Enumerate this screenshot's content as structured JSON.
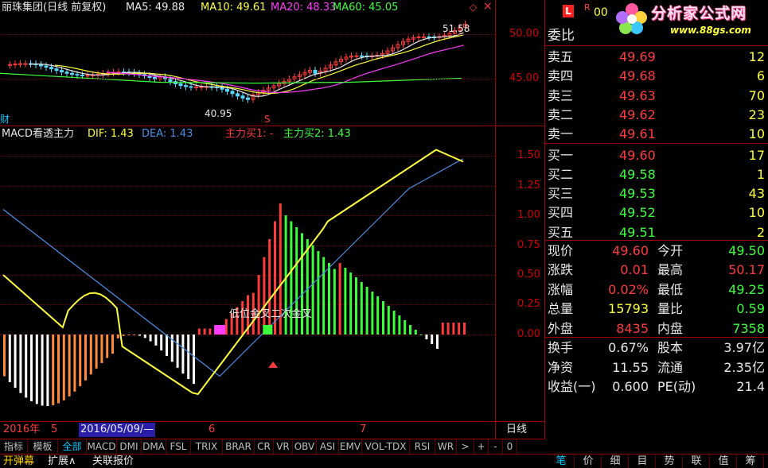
{
  "upper": {
    "stock_title": "丽珠集团(日线 前复权)",
    "ma5_label": "MA5: 49.88",
    "ma10_label": "MA10: 49.61",
    "ma20_label": "MA20: 48.33",
    "ma60_label": "MA60: 45.05",
    "high_marker": "51.58",
    "low_marker": "40.95",
    "side_glyph": "财",
    "buy_glyph": "S",
    "y_ticks": [
      "50.00",
      "45.00"
    ]
  },
  "lower": {
    "indicator_title": "MACD看透主力",
    "dif_label": "DIF: 1.43",
    "dea_label": "DEA: 1.43",
    "buy1_label": "主力买1: -",
    "buy2_label": "主力买2: 1.43",
    "annotation1": "低位金叉",
    "annotation2": "二次金叉",
    "y_ticks": [
      "1.50",
      "1.25",
      "1.00",
      "0.75",
      "0.50",
      "0.25",
      "0.00"
    ]
  },
  "timeline": {
    "year_label": "2016年",
    "m5": "5",
    "date_box": "2016/05/09/—",
    "m6": "6",
    "m7": "7",
    "period": "日线"
  },
  "tabs": [
    "指标",
    "模板",
    "全部",
    "MACD",
    "DMI",
    "DMA",
    "FSL",
    "TRIX",
    "BRAR",
    "CR",
    "VR",
    "OBV",
    "ASI",
    "EMV",
    "VOL-TDX",
    "RSI",
    "WR",
    ">",
    "+",
    "-",
    "0"
  ],
  "bottom_tabs": [
    "开弹幕",
    "扩展∧",
    "关联报价"
  ],
  "right_tabs": [
    "笔",
    "价",
    "细",
    "目",
    "势",
    "联",
    "值",
    "筹"
  ],
  "quote_header": {
    "l_badge": "L",
    "r_badge": "R",
    "code_fragment": "00",
    "logo_text": "分析家公式网",
    "logo_url": "www.88gs.com",
    "weibi_label": "委比"
  },
  "order_book": [
    {
      "label": "卖五",
      "price": "49.69",
      "vol": "12"
    },
    {
      "label": "卖四",
      "price": "49.68",
      "vol": "6"
    },
    {
      "label": "卖三",
      "price": "49.63",
      "vol": "70"
    },
    {
      "label": "卖二",
      "price": "49.62",
      "vol": "23"
    },
    {
      "label": "卖一",
      "price": "49.61",
      "vol": "10"
    },
    {
      "label": "买一",
      "price": "49.60",
      "vol": "17"
    },
    {
      "label": "买二",
      "price": "49.58",
      "vol": "1"
    },
    {
      "label": "买三",
      "price": "49.53",
      "vol": "43"
    },
    {
      "label": "买四",
      "price": "49.52",
      "vol": "10"
    },
    {
      "label": "买五",
      "price": "49.51",
      "vol": "2"
    }
  ],
  "stats": [
    {
      "l1": "现价",
      "v1": "49.60",
      "c1": "red",
      "l2": "今开",
      "v2": "49.50",
      "c2": "green"
    },
    {
      "l1": "涨跌",
      "v1": "0.01",
      "c1": "red",
      "l2": "最高",
      "v2": "50.17",
      "c2": "red"
    },
    {
      "l1": "涨幅",
      "v1": "0.02%",
      "c1": "red",
      "l2": "最低",
      "v2": "49.25",
      "c2": "green"
    },
    {
      "l1": "总量",
      "v1": "15793",
      "c1": "yellow",
      "l2": "量比",
      "v2": "0.59",
      "c2": "green"
    },
    {
      "l1": "外盘",
      "v1": "8435",
      "c1": "red",
      "l2": "内盘",
      "v2": "7358",
      "c2": "green"
    }
  ],
  "finance": [
    {
      "l1": "换手",
      "v1": "0.67%",
      "l2": "股本",
      "v2": "3.97亿"
    },
    {
      "l1": "净资",
      "v1": "11.55",
      "l2": "流通",
      "v2": "2.35亿"
    },
    {
      "l1": "收益(一)",
      "v1": "0.600",
      "l2": "PE(动)",
      "v2": "21.4"
    }
  ],
  "colors": {
    "frame": "#a00000",
    "ma5": "#e8e8e8",
    "ma10": "#ffff3c",
    "ma20": "#ff3cff",
    "ma60": "#3cff3c",
    "dif": "#ffff3c",
    "dea": "#4a90e8",
    "bar_up": "#ff3c3c",
    "bar_down": "#3cff3c"
  }
}
